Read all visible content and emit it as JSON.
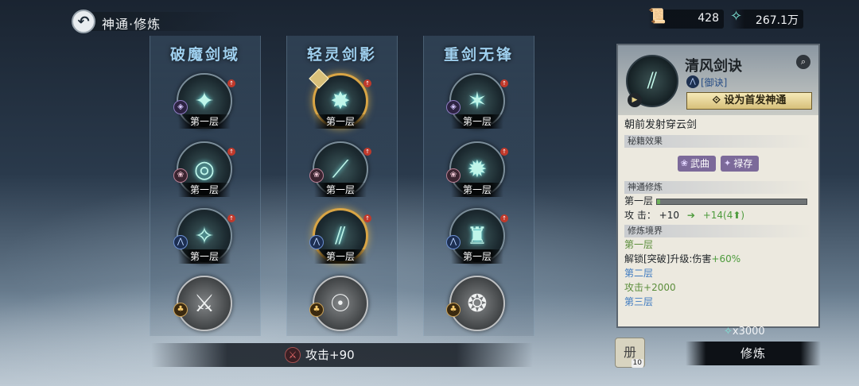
{
  "header": {
    "back_icon": "back-arrow-icon",
    "title": "神通·修炼",
    "currency1": {
      "icon": "scroll-icon",
      "value": "428"
    },
    "currency2": {
      "icon": "crystal-icon",
      "value": "267.1万"
    }
  },
  "columns": [
    {
      "title": "破魔剑域",
      "skills": [
        {
          "level": "第一层",
          "glyph": "✦",
          "badge": "◈",
          "badge_type": "purple",
          "upgrade": true
        },
        {
          "level": "第一层",
          "glyph": "◎",
          "badge": "❀",
          "badge_type": "red",
          "upgrade": true
        },
        {
          "level": "第一层",
          "glyph": "✧",
          "badge": "⋀",
          "badge_type": "blue",
          "upgrade": true
        },
        {
          "level": "",
          "glyph": "⚔",
          "badge": "♣",
          "badge_type": "lock",
          "upgrade": false
        }
      ]
    },
    {
      "title": "轻灵剑影",
      "skills": [
        {
          "level": "第一层",
          "glyph": "✸",
          "badge": "",
          "badge_type": "",
          "upgrade": true
        },
        {
          "level": "第一层",
          "glyph": "⟋",
          "badge": "❀",
          "badge_type": "red",
          "upgrade": true
        },
        {
          "level": "第一层",
          "glyph": "⫽",
          "badge": "⋀",
          "badge_type": "blue",
          "upgrade": true
        },
        {
          "level": "",
          "glyph": "☉",
          "badge": "♣",
          "badge_type": "lock",
          "upgrade": false
        }
      ]
    },
    {
      "title": "重剑无锋",
      "skills": [
        {
          "level": "第一层",
          "glyph": "✶",
          "badge": "◈",
          "badge_type": "purple",
          "upgrade": true
        },
        {
          "level": "第一层",
          "glyph": "✹",
          "badge": "❀",
          "badge_type": "red",
          "upgrade": true
        },
        {
          "level": "第一层",
          "glyph": "♜",
          "badge": "⋀",
          "badge_type": "blue",
          "upgrade": true
        },
        {
          "level": "",
          "glyph": "❂",
          "badge": "♣",
          "badge_type": "lock",
          "upgrade": false
        }
      ]
    }
  ],
  "bottom": {
    "attack_total": "攻击+90",
    "attack_icon": "sword-icon"
  },
  "panel": {
    "name": "清风剑诀",
    "type": "[御诀]",
    "set_first_button": "设为首发神通",
    "description": "朝前发射穿云剑",
    "sec_secret": "秘籍效果",
    "chips": [
      {
        "icon": "❀",
        "label": "武曲"
      },
      {
        "icon": "✦",
        "label": "禄存"
      }
    ],
    "sec_training": "神通修炼",
    "current_level": "第一层",
    "progress": 0.02,
    "attack_label": "攻 击：",
    "attack_now": "+10",
    "attack_next": "+14(4⬆)",
    "sec_realm": "修炼境界",
    "realm": [
      {
        "name": "第一层",
        "effect_prefix": "解锁[突破]升级:伤害",
        "effect_value": "+60%"
      },
      {
        "name": "第二层",
        "effect_prefix": "攻击",
        "effect_value": "+2000"
      },
      {
        "name": "第三层",
        "effect_prefix": "",
        "effect_value": ""
      }
    ]
  },
  "cost": "x3000",
  "book_count": "10",
  "train_button": "修炼"
}
